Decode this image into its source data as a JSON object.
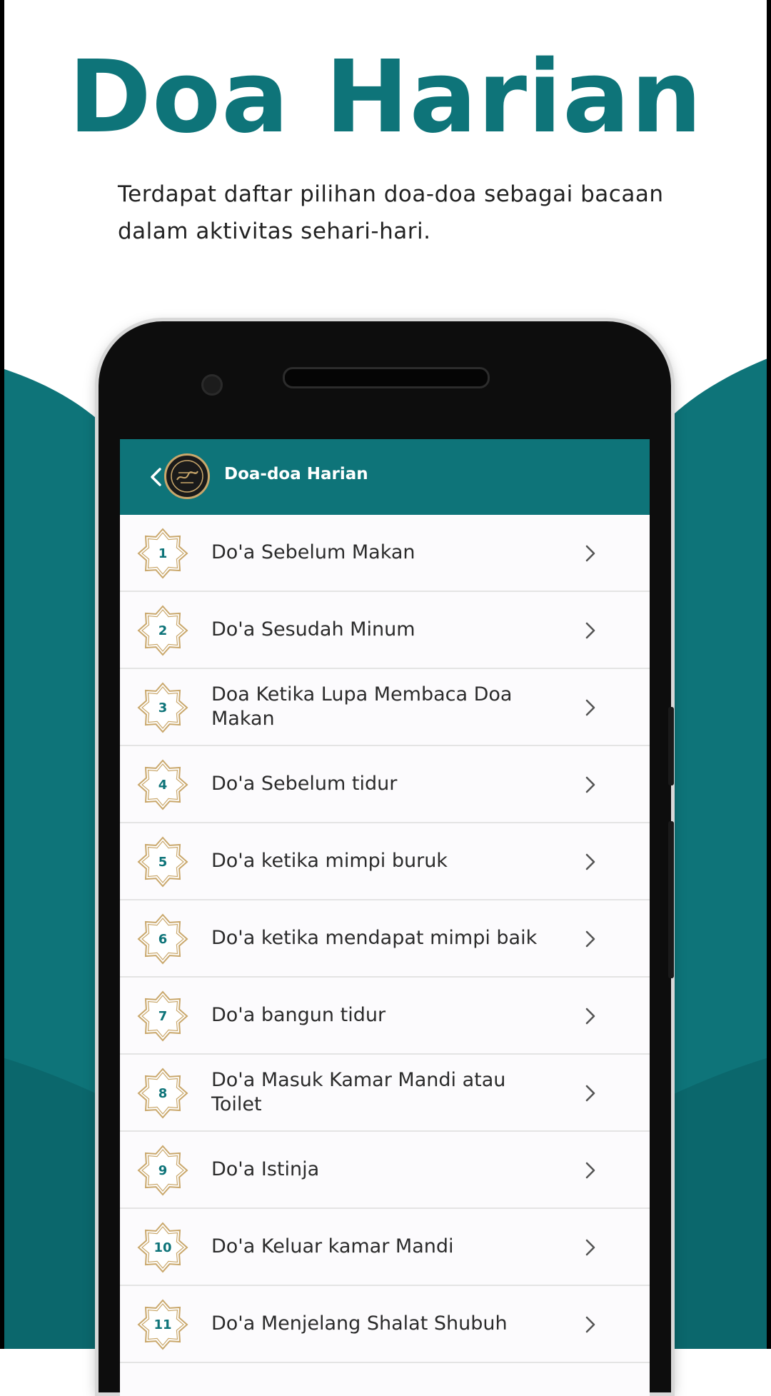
{
  "hero": {
    "title": "Doa Harian",
    "description": "Terdapat daftar pilihan doa-doa sebagai bacaan dalam aktivitas sehari-hari."
  },
  "app": {
    "title": "Doa-doa Harian",
    "accent_color": "#0e7479",
    "badge_color": "#c9a76b"
  },
  "items": [
    {
      "number": "1",
      "label": "Do'a Sebelum Makan"
    },
    {
      "number": "2",
      "label": "Do'a Sesudah Minum"
    },
    {
      "number": "3",
      "label": "Doa Ketika Lupa Membaca Doa Makan"
    },
    {
      "number": "4",
      "label": "Do'a Sebelum tidur"
    },
    {
      "number": "5",
      "label": "Do'a ketika mimpi buruk"
    },
    {
      "number": "6",
      "label": "Do'a ketika mendapat mimpi baik"
    },
    {
      "number": "7",
      "label": "Do'a bangun tidur"
    },
    {
      "number": "8",
      "label": "Do'a Masuk Kamar Mandi atau Toilet"
    },
    {
      "number": "9",
      "label": "Do'a Istinja"
    },
    {
      "number": "10",
      "label": "Do'a Keluar kamar Mandi"
    },
    {
      "number": "11",
      "label": "Do'a Menjelang Shalat Shubuh"
    }
  ]
}
